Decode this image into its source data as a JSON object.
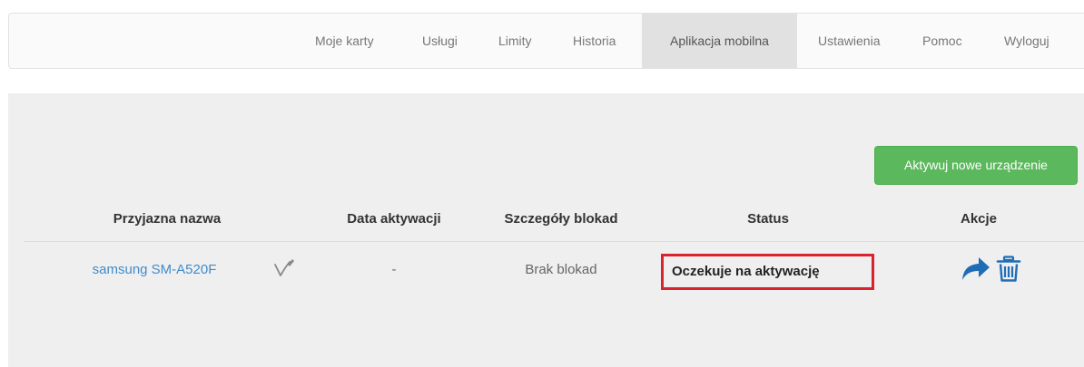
{
  "nav": {
    "items": [
      {
        "label": "Moje karty",
        "active": false
      },
      {
        "label": "Usługi",
        "active": false
      },
      {
        "label": "Limity",
        "active": false
      },
      {
        "label": "Historia",
        "active": false
      },
      {
        "label": "Aplikacja mobilna",
        "active": true
      },
      {
        "label": "Ustawienia",
        "active": false
      },
      {
        "label": "Pomoc",
        "active": false
      },
      {
        "label": "Wyloguj",
        "active": false
      }
    ]
  },
  "main": {
    "activate_button_label": "Aktywuj nowe urządzenie",
    "table": {
      "columns": [
        "Przyjazna nazwa",
        "Data aktywacji",
        "Szczegóły blokad",
        "Status",
        "Akcje"
      ],
      "rows": [
        {
          "name": "samsung SM-A520F",
          "activation_date": "-",
          "lock_details": "Brak blokad",
          "status": "Oczekuje na aktywację",
          "icons": [
            "edit-signature-icon",
            "share-arrow-icon",
            "trash-icon"
          ]
        }
      ]
    }
  },
  "colors": {
    "accent_blue": "#428bca",
    "success_green": "#5cb85c",
    "highlight_red": "#d9232e",
    "panel_gray": "#efefef",
    "nav_active_gray": "#e1e1e1"
  }
}
